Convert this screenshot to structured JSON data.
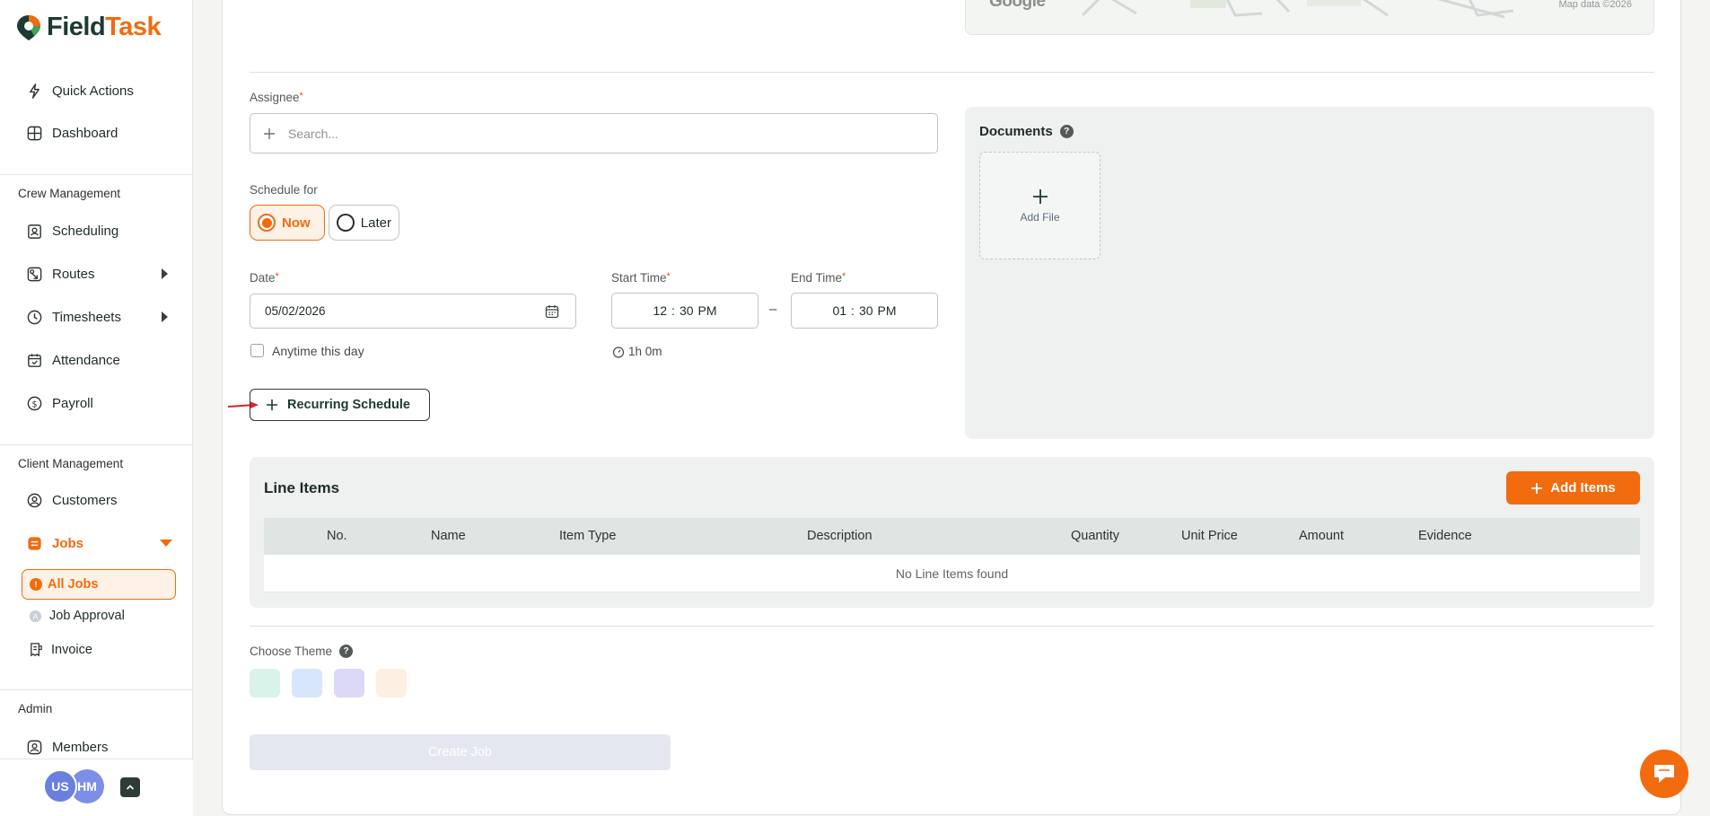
{
  "brand": {
    "name_part1": "Field",
    "name_part2": "Task"
  },
  "sidebar": {
    "quick_actions": "Quick Actions",
    "dashboard": "Dashboard",
    "crew_title": "Crew Management",
    "scheduling": "Scheduling",
    "routes": "Routes",
    "timesheets": "Timesheets",
    "attendance": "Attendance",
    "payroll": "Payroll",
    "client_title": "Client Management",
    "customers": "Customers",
    "jobs": "Jobs",
    "all_jobs": "All Jobs",
    "job_approval": "Job Approval",
    "invoice": "Invoice",
    "admin_title": "Admin",
    "members": "Members",
    "avatar1": "US",
    "avatar2": "HM"
  },
  "map": {
    "logo": "Google",
    "credit": "Map data ©2026"
  },
  "form": {
    "assignee_label": "Assignee",
    "assignee_placeholder": "Search...",
    "schedule_label": "Schedule for",
    "schedule_now": "Now",
    "schedule_later": "Later",
    "schedule_selected": "Now",
    "date_label": "Date",
    "date_value": "05/02/2026",
    "start_label": "Start Time",
    "start_hour": "12",
    "start_min": "30",
    "start_ampm": "PM",
    "time_sep": "–",
    "end_label": "End Time",
    "end_hour": "01",
    "end_min": "30",
    "end_ampm": "PM",
    "anytime_label": "Anytime this day",
    "duration": "1h 0m",
    "recurring_button": "Recurring Schedule",
    "required_mark": "*"
  },
  "documents": {
    "title": "Documents",
    "help": "?",
    "add_file": "Add File"
  },
  "line_items": {
    "title": "Line Items",
    "add_button": "Add Items",
    "columns": [
      "No.",
      "Name",
      "Item Type",
      "Description",
      "Quantity",
      "Unit Price",
      "Amount",
      "Evidence"
    ],
    "empty_text": "No Line Items found"
  },
  "theme": {
    "label": "Choose Theme",
    "help": "?",
    "swatches": [
      "#d9f3ea",
      "#d8e6fb",
      "#dcd8f7",
      "#fdf0e3"
    ]
  },
  "create_button": "Create Job",
  "colors": {
    "accent": "#f26b0f",
    "brand_dark": "#1d3a33"
  }
}
